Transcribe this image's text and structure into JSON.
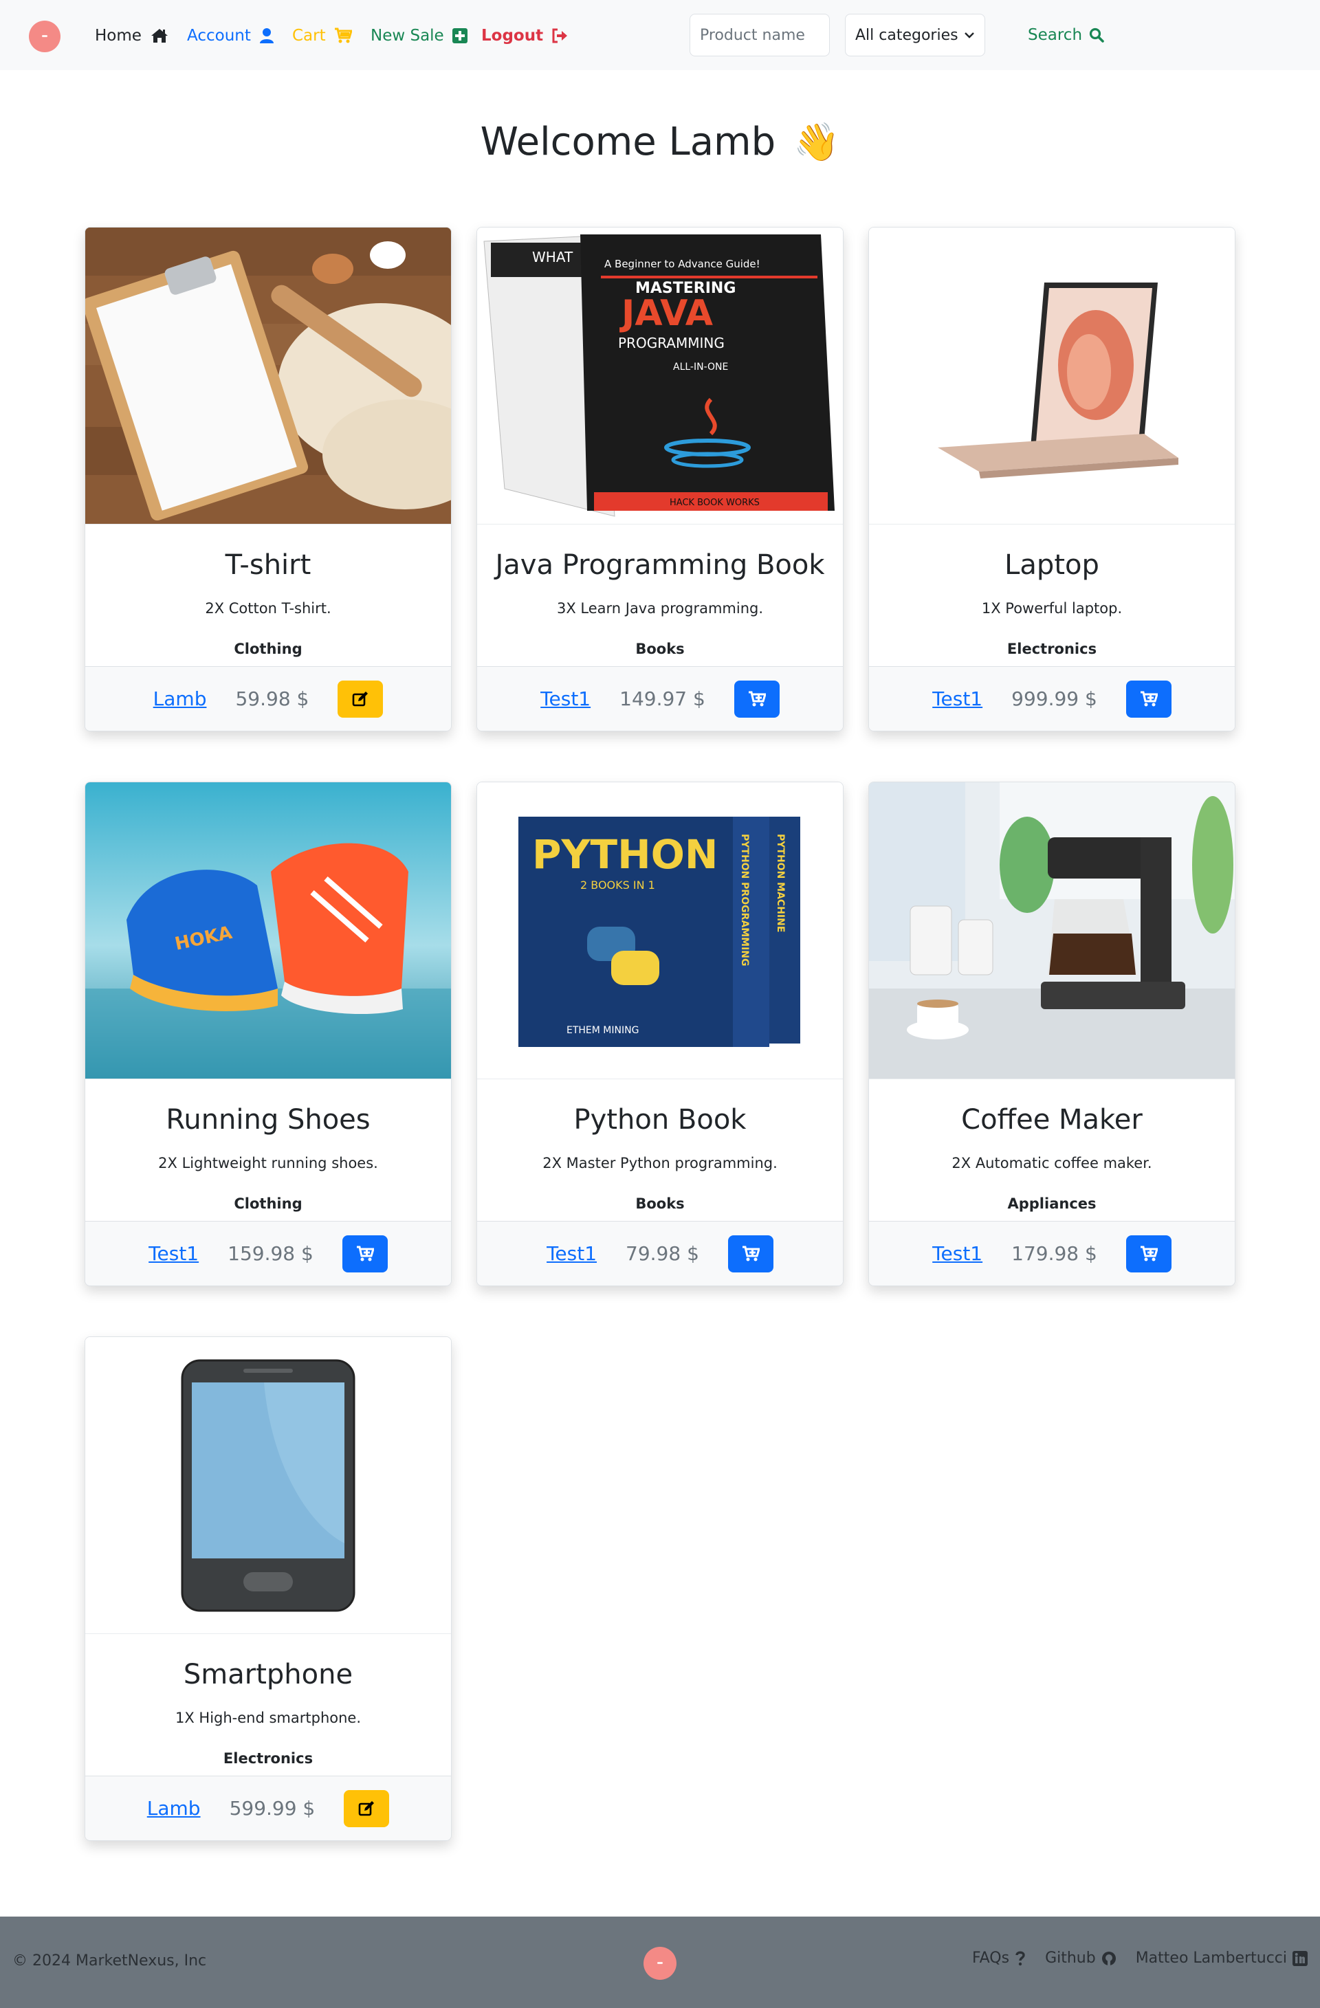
{
  "nav": {
    "home": "Home",
    "account": "Account",
    "cart": "Cart",
    "new_sale": "New Sale",
    "logout": "Logout",
    "search_placeholder": "Product name",
    "category_selected": "All categories",
    "search": "Search"
  },
  "welcome": {
    "text": "Welcome Lamb",
    "emoji": "👋"
  },
  "products": [
    {
      "title": "T-shirt",
      "description": "2X Cotton T-shirt.",
      "category": "Clothing",
      "seller": "Lamb",
      "price": "59.98 $",
      "action": "edit",
      "image": "clipboard-dough"
    },
    {
      "title": "Java Programming Book",
      "description": "3X Learn Java programming.",
      "category": "Books",
      "seller": "Test1",
      "price": "149.97 $",
      "action": "cart",
      "image": "java-book",
      "image_text": {
        "back_heading": "WHAT",
        "tagline": "A Beginner to Advance Guide!",
        "line1": "MASTERING",
        "line2": "JAVA",
        "line3": "PROGRAMMING",
        "line4": "ALL-IN-ONE",
        "publisher": "HACK BOOK WORKS"
      }
    },
    {
      "title": "Laptop",
      "description": "1X Powerful laptop.",
      "category": "Electronics",
      "seller": "Test1",
      "price": "999.99 $",
      "action": "cart",
      "image": "laptop"
    },
    {
      "title": "Running Shoes",
      "description": "2X Lightweight running shoes.",
      "category": "Clothing",
      "seller": "Test1",
      "price": "159.98 $",
      "action": "cart",
      "image": "running-shoes",
      "image_text": {
        "brand": "HOKA"
      }
    },
    {
      "title": "Python Book",
      "description": "2X Master Python programming.",
      "category": "Books",
      "seller": "Test1",
      "price": "79.98 $",
      "action": "cart",
      "image": "python-book",
      "image_text": {
        "cover_title": "PYTHON",
        "subtitle": "2 BOOKS IN 1",
        "author": "ETHEM MINING",
        "spine1": "PYTHON PROGRAMMING",
        "spine2": "PYTHON MACHINE"
      }
    },
    {
      "title": "Coffee Maker",
      "description": "2X Automatic coffee maker.",
      "category": "Appliances",
      "seller": "Test1",
      "price": "179.98 $",
      "action": "cart",
      "image": "coffee-maker"
    },
    {
      "title": "Smartphone",
      "description": "1X High-end smartphone.",
      "category": "Electronics",
      "seller": "Lamb",
      "price": "599.99 $",
      "action": "edit",
      "image": "smartphone"
    }
  ],
  "footer": {
    "copyright": "© 2024 MarketNexus, Inc",
    "faqs": "FAQs",
    "github": "Github",
    "author": "Matteo Lambertucci"
  },
  "colors": {
    "primary": "#0d6efd",
    "warning": "#ffc107",
    "success": "#198754",
    "danger": "#dc3545",
    "logo": "#f48a86",
    "footer_bg": "#6c757d"
  }
}
